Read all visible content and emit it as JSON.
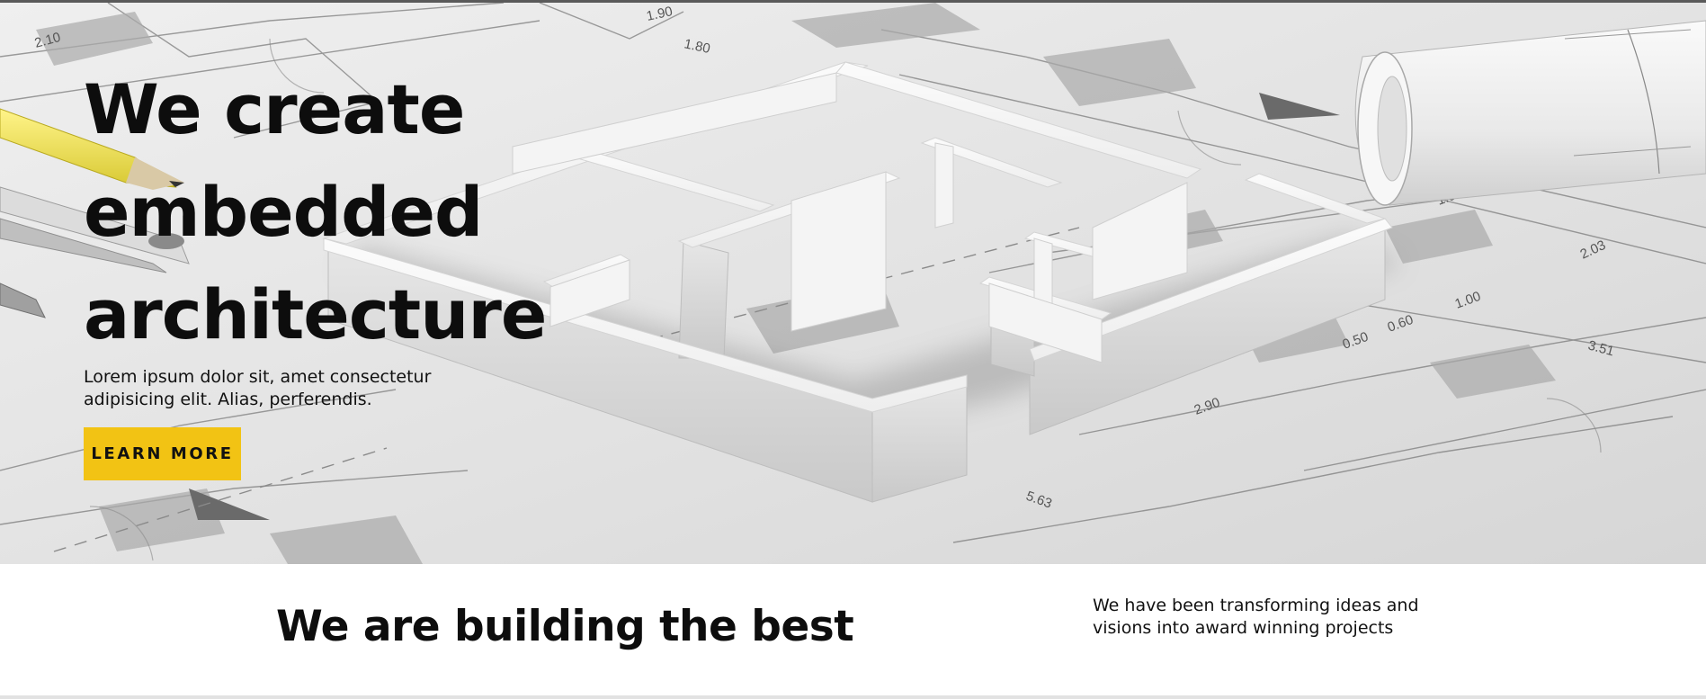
{
  "hero": {
    "title_lines": [
      "We create",
      "embedded",
      "architecture"
    ],
    "subtitle": "Lorem ipsum dolor sit, amet consectetur adipisicing elit. Alias, perferendis.",
    "cta_label": "LEARN MORE",
    "accent_color": "#f2c314",
    "plan_labels": [
      "2.10",
      "1.90",
      "1.80",
      "1.96",
      "2.03",
      "1.00",
      "0.60",
      "0.50",
      "2.90",
      "5.63",
      "3.51"
    ]
  },
  "intro": {
    "title": "We are building the best",
    "text": "We have been transforming ideas and visions into award winning projects"
  }
}
